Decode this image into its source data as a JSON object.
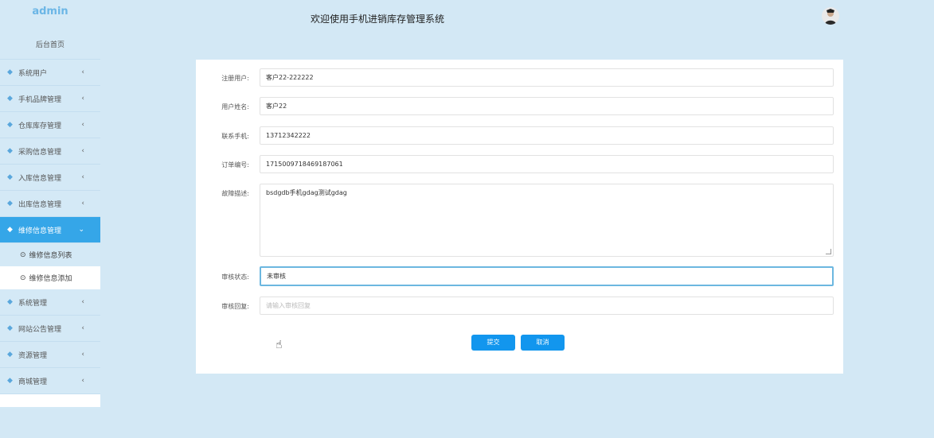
{
  "sidebar": {
    "brand": "admin",
    "home": "后台首页",
    "items": [
      {
        "label": "系统用户"
      },
      {
        "label": "手机品牌管理"
      },
      {
        "label": "仓库库存管理"
      },
      {
        "label": "采购信息管理"
      },
      {
        "label": "入库信息管理"
      },
      {
        "label": "出库信息管理"
      },
      {
        "label": "维修信息管理"
      },
      {
        "label": "系统管理"
      },
      {
        "label": "网站公告管理"
      },
      {
        "label": "资源管理"
      },
      {
        "label": "商城管理"
      }
    ],
    "subitems": [
      {
        "label": "维修信息列表"
      },
      {
        "label": "维修信息添加"
      }
    ]
  },
  "header": {
    "title": "欢迎使用手机进销库存管理系统"
  },
  "form": {
    "username": {
      "label": "注册用户:",
      "value": "客户22-222222"
    },
    "name": {
      "label": "用户姓名:",
      "value": "客户22"
    },
    "phone": {
      "label": "联系手机:",
      "value": "13712342222"
    },
    "order_no": {
      "label": "订单编号:",
      "value": "1715009718469187061"
    },
    "fault": {
      "label": "故障描述:",
      "value": "bsdgdb手机gdag测试gdag"
    },
    "status": {
      "label": "审核状态:",
      "value": "未审核"
    },
    "reply": {
      "label": "审核回复:",
      "placeholder": "请输入审核回复"
    },
    "submit_label": "提交",
    "cancel_label": "取消"
  }
}
